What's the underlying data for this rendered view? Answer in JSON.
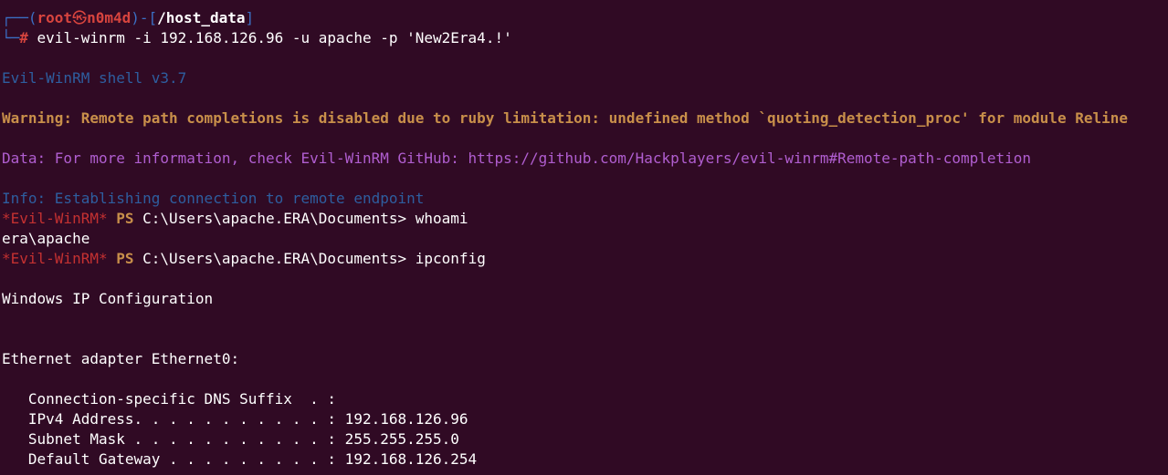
{
  "prompt": {
    "corner_top": "┌──(",
    "user": "root",
    "at_symbol": "㉿",
    "host": "n0m4d",
    "bracket_mid": ")-[",
    "path": "/host_data",
    "bracket_close": "]",
    "corner_bottom": "└─",
    "hash": "#",
    "command": " evil-winrm -i 192.168.126.96 -u apache -p 'New2Era4.!'"
  },
  "banner": "Evil-WinRM shell v3.7",
  "warning": "Warning: Remote path completions is disabled due to ruby limitation: undefined method `quoting_detection_proc' for module Reline",
  "data_line": "Data: For more information, check Evil-WinRM GitHub: https://github.com/Hackplayers/evil-winrm#Remote-path-completion",
  "info": "Info: Establishing connection to remote endpoint",
  "ps_prompt": {
    "tag": "*Evil-WinRM*",
    "ps": "PS",
    "path": "C:\\Users\\apache.ERA\\Documents>"
  },
  "commands": [
    {
      "cmd": "whoami"
    },
    {
      "cmd": "ipconfig"
    }
  ],
  "whoami_output": "era\\apache",
  "ipconfig": {
    "title": "Windows IP Configuration",
    "adapter": "Ethernet adapter Ethernet0:",
    "rows": [
      "   Connection-specific DNS Suffix  . :",
      "   IPv4 Address. . . . . . . . . . . : 192.168.126.96",
      "   Subnet Mask . . . . . . . . . . . : 255.255.255.0",
      "   Default Gateway . . . . . . . . . : 192.168.126.254"
    ]
  },
  "colors": {
    "background": "#300a24",
    "prompt_blue": "#3b6fc4",
    "prompt_red": "#d7443e",
    "warning": "#c88f4a",
    "data": "#b05ed0",
    "info": "#2e5e9f"
  }
}
